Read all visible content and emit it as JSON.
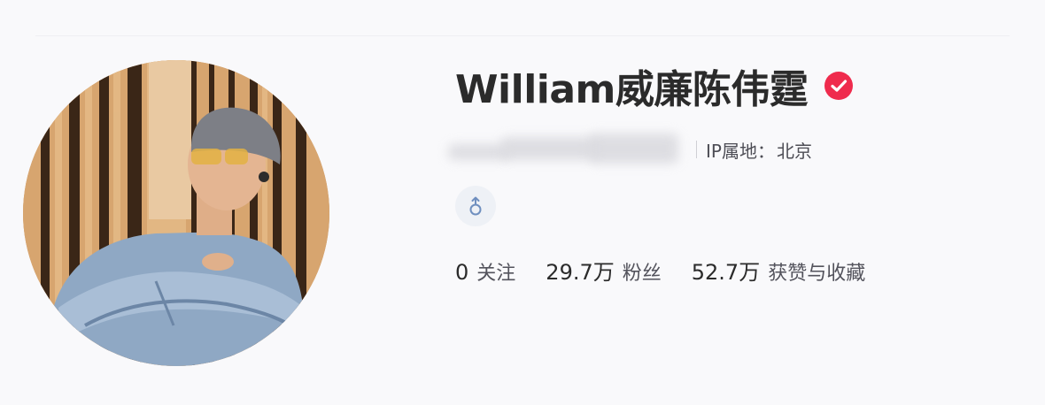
{
  "profile": {
    "name": "William威廉陈伟霆",
    "verified_icon": "verified-check-icon",
    "ip_label": "IP属地：",
    "ip_value": "北京",
    "gender_icon": "male-icon",
    "stats": [
      {
        "value": "0",
        "label": "关注"
      },
      {
        "value": "29.7万",
        "label": "粉丝"
      },
      {
        "value": "52.7万",
        "label": "获赞与收藏"
      }
    ]
  },
  "colors": {
    "verified": "#ef2b4d",
    "text": "#2b2b2b",
    "muted": "#53535c",
    "gender_chip_bg": "#eef1f6",
    "gender_icon": "#6f8fbf"
  }
}
